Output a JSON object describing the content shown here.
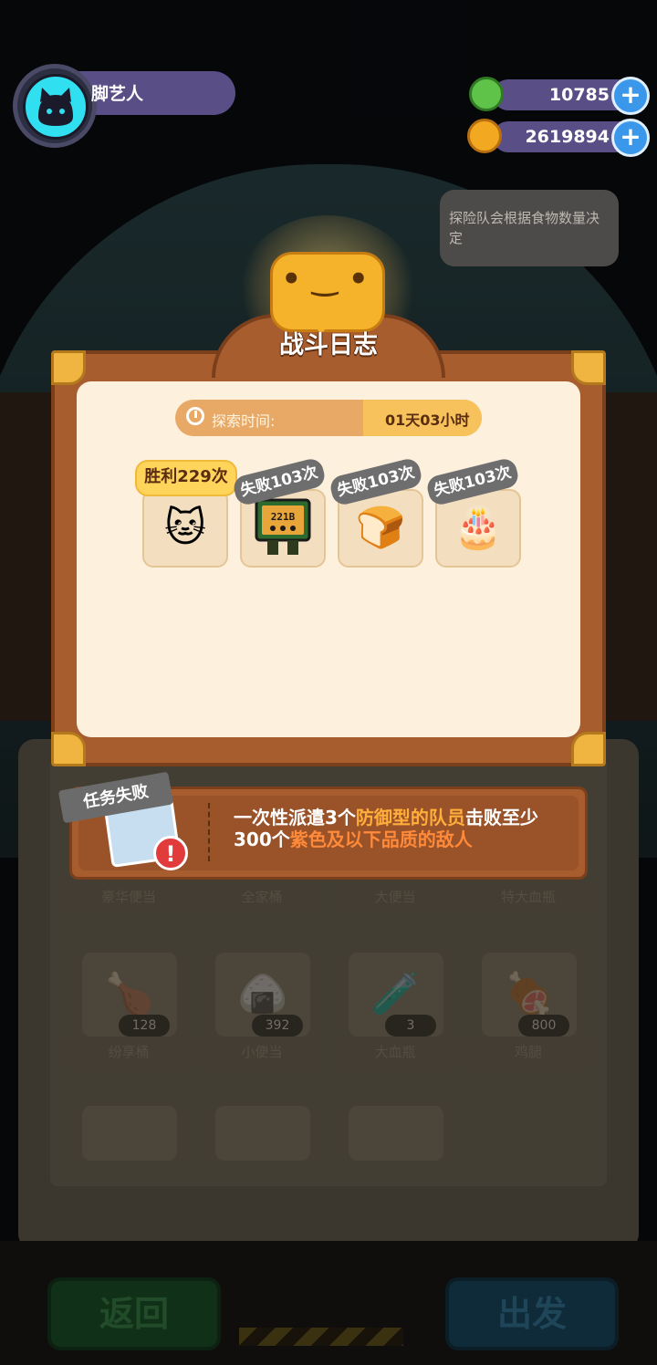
{
  "player": {
    "name": "脚艺人"
  },
  "currency": [
    {
      "icon": "green-gem-icon",
      "value": "10785"
    },
    {
      "icon": "gold-planet-coin-icon",
      "value": "2619894"
    }
  ],
  "tip": "探险队会根据食物数量决定",
  "battle_log": {
    "title": "战斗日志",
    "explore_time_label": "探索时间:",
    "explore_time_value": "01天03小时",
    "units": [
      {
        "result": "胜利229次",
        "outcome": "win",
        "icon": "calico-cat-hero-icon"
      },
      {
        "result": "失败103次",
        "outcome": "lose",
        "icon": "221b-box-monster-icon"
      },
      {
        "result": "失败103次",
        "outcome": "lose",
        "icon": "toast-monster-icon"
      },
      {
        "result": "失败103次",
        "outcome": "lose",
        "icon": "cake-monster-icon"
      }
    ],
    "unit_card_labels": {
      "box_sign": "221B"
    }
  },
  "mission": {
    "tag": "任务失败",
    "text_parts": {
      "a": "一次性派遣3个",
      "b": "防御型的队员",
      "c": "击败至少300个",
      "d": "紫色及以下品质的敌人"
    }
  },
  "food": {
    "row1_labels": [
      "豪华便当",
      "全家桶",
      "大便当",
      "特大血瓶"
    ],
    "row2": [
      {
        "label": "纷享桶",
        "count": "128",
        "icon": "fried-chicken-bucket-icon"
      },
      {
        "label": "小便当",
        "count": "392",
        "icon": "rice-bento-icon"
      },
      {
        "label": "大血瓶",
        "count": "3",
        "icon": "red-potion-icon"
      },
      {
        "label": "鸡腿",
        "count": "800",
        "icon": "drumstick-icon"
      }
    ]
  },
  "buttons": {
    "back": "返回",
    "go": "出发"
  },
  "colors": {
    "modal_frame": "#a85d2f",
    "modal_content": "#fdf1de",
    "highlight": "#ffae3c",
    "win_badge": "#ffd45a",
    "lose_badge": "#6e6e6e"
  }
}
